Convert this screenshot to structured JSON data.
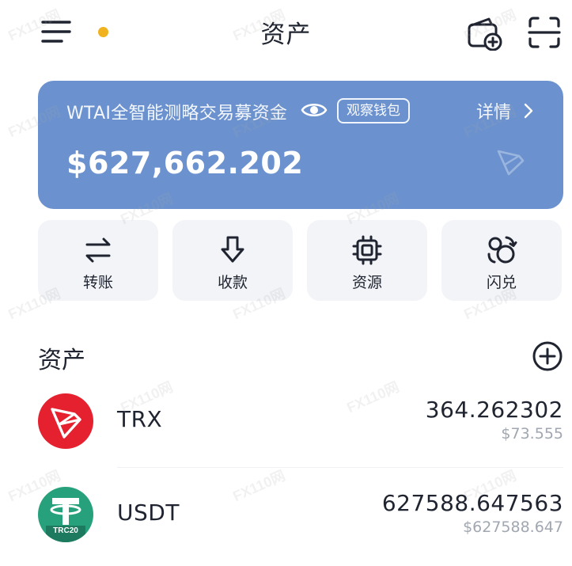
{
  "header": {
    "title": "资产",
    "menu_icon": "menu-icon",
    "wallet_add_icon": "wallet-add-icon",
    "scan_icon": "scan-icon",
    "notification_color": "#f0b21f"
  },
  "wallet": {
    "name": "WTAI全智能测略交易募资金",
    "badge": "观察钱包",
    "details_label": "详情",
    "balance": "$627,662.202",
    "card_color": "#6b92cf",
    "eye_icon": "eye-icon"
  },
  "actions": [
    {
      "label": "转账",
      "icon": "transfer-icon"
    },
    {
      "label": "收款",
      "icon": "receive-icon"
    },
    {
      "label": "资源",
      "icon": "chip-icon"
    },
    {
      "label": "闪兑",
      "icon": "swap-icon"
    }
  ],
  "assets": {
    "heading": "资产",
    "add_icon": "plus-circle-icon",
    "items": [
      {
        "symbol": "TRX",
        "amount": "364.262302",
        "fiat": "$73.555",
        "logo_color": "#e5202f"
      },
      {
        "symbol": "USDT",
        "amount": "627588.647563",
        "fiat": "$627588.647",
        "logo_color": "#26a17b",
        "logo_badge": "TRC20"
      }
    ]
  },
  "watermark": "FX110网"
}
